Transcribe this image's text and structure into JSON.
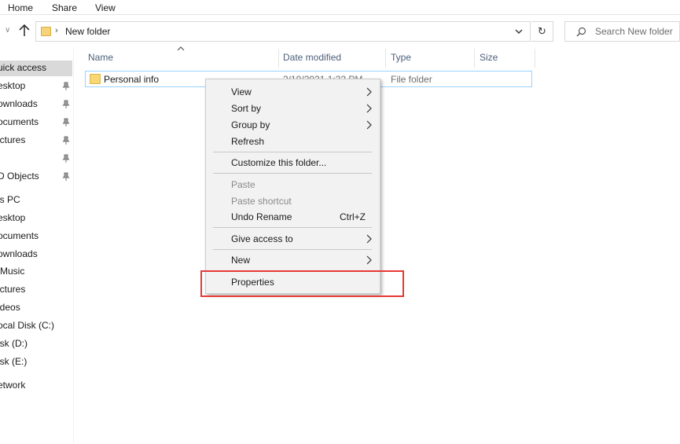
{
  "ribbon": {
    "tabs": [
      "Home",
      "Share",
      "View"
    ]
  },
  "address": {
    "path": "New folder"
  },
  "search": {
    "placeholder": "Search New folder"
  },
  "sidebar": {
    "items": [
      {
        "label": "uick access",
        "pinned": false,
        "selected": true
      },
      {
        "label": "esktop",
        "pinned": true
      },
      {
        "label": "ownloads",
        "pinned": true
      },
      {
        "label": "ocuments",
        "pinned": true
      },
      {
        "label": "ictures",
        "pinned": true
      },
      {
        "label": "",
        "pinned": true
      },
      {
        "label": "D Objects",
        "pinned": true
      },
      {
        "label": "is PC",
        "pinned": false
      },
      {
        "label": "esktop",
        "pinned": false
      },
      {
        "label": "ocuments",
        "pinned": false
      },
      {
        "label": "ownloads",
        "pinned": false
      },
      {
        "label": "Music",
        "pinned": false
      },
      {
        "label": "ictures",
        "pinned": false
      },
      {
        "label": "ideos",
        "pinned": false
      },
      {
        "label": "ocal Disk (C:)",
        "pinned": false
      },
      {
        "label": "isk (D:)",
        "pinned": false
      },
      {
        "label": "isk (E:)",
        "pinned": false
      },
      {
        "label": "etwork",
        "pinned": false
      }
    ]
  },
  "columns": {
    "name": "Name",
    "date": "Date modified",
    "type": "Type",
    "size": "Size"
  },
  "files": [
    {
      "name": "Personal info",
      "date": "2/10/2021 1:32 PM",
      "type": "File folder"
    }
  ],
  "context_menu": {
    "view": "View",
    "sort_by": "Sort by",
    "group_by": "Group by",
    "refresh": "Refresh",
    "customize": "Customize this folder...",
    "paste": "Paste",
    "paste_shortcut": "Paste shortcut",
    "undo_rename": "Undo Rename",
    "undo_shortcut": "Ctrl+Z",
    "give_access": "Give access to",
    "new": "New",
    "properties": "Properties"
  },
  "colors": {
    "highlight": "#e53935",
    "selection_border": "#99d1ff",
    "folder": "#f8d775"
  }
}
